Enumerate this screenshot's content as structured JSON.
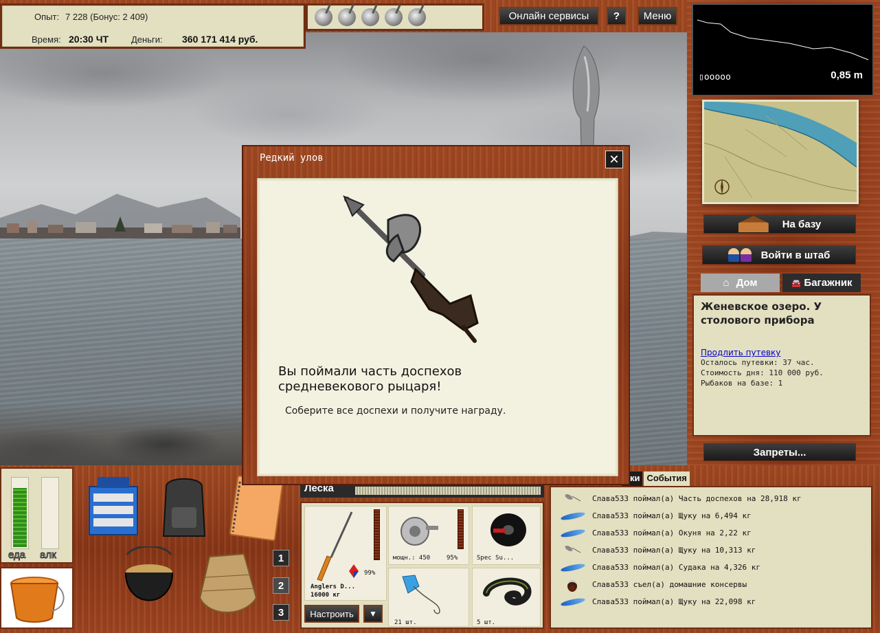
{
  "hud": {
    "experience_label": "Опыт:",
    "experience_value": "7 228 (Бонус: 2 409)",
    "time_label": "Время:",
    "time_value": "20:30 ЧТ",
    "money_label": "Деньги:",
    "money_value": "360 171 414 руб."
  },
  "top_buttons": {
    "online": "Онлайн сервисы",
    "help": "?",
    "menu": "Меню"
  },
  "depth": {
    "value": "0,85 m",
    "battery": "▯ooooo"
  },
  "right": {
    "to_base": "На базу",
    "headquarters": "Войти в штаб",
    "tab_home": "Дом",
    "tab_trunk": "Багажник",
    "location_title": "Женевское озеро. У столового прибора",
    "extend_link": "Продлить путевку",
    "info_lines": [
      "Осталось путевки: 37 час.",
      "Стоимость дня: 110 000 руб.",
      "Рыбаков на базе: 1"
    ],
    "restrictions": "Запреты..."
  },
  "needs": {
    "food_label": "еда",
    "alcohol_label": "алк",
    "food_level": 0.85,
    "alcohol_level": 0.0
  },
  "slots": [
    "1",
    "2",
    "3"
  ],
  "gear": {
    "line_label": "Леска",
    "rod_name": "Anglers D...",
    "rod_weight": "16000 кг",
    "rod_condition": "99%",
    "reel_power": "мощн.: 450",
    "reel_condition": "95%",
    "line_name": "Spec Su...",
    "bait_count_1": "21 шт.",
    "bait_count_2": "5 шт.",
    "configure": "Настроить",
    "dropdown": "▼"
  },
  "log": {
    "tab_partial": "оки",
    "tab_events": "События",
    "entries": [
      {
        "icon": "lure",
        "text": "Слава533 поймал(а) Часть доспехов на 28,918 кг"
      },
      {
        "icon": "fish",
        "text": "Слава533 поймал(а) Щуку на 6,494 кг"
      },
      {
        "icon": "fish",
        "text": "Слава533 поймал(а) Окуня на 2,22 кг"
      },
      {
        "icon": "lure",
        "text": "Слава533 поймал(а) Щуку на 10,313 кг"
      },
      {
        "icon": "fish",
        "text": "Слава533 поймал(а) Судака на 4,326 кг"
      },
      {
        "icon": "can",
        "text": "Слава533 съел(а) домашние консервы"
      },
      {
        "icon": "fish",
        "text": "Слава533 поймал(а) Щуку на 22,098 кг"
      }
    ]
  },
  "modal": {
    "title": "Редкий улов",
    "close": "✕",
    "headline_1": "Вы поймали часть доспехов",
    "headline_2": "средневекового рыцаря!",
    "subtext": "Соберите все доспехи и получите награду."
  },
  "colors": {
    "panel_bg": "#e3dfc1",
    "wood": "#8a3717",
    "link": "#0000cc"
  }
}
